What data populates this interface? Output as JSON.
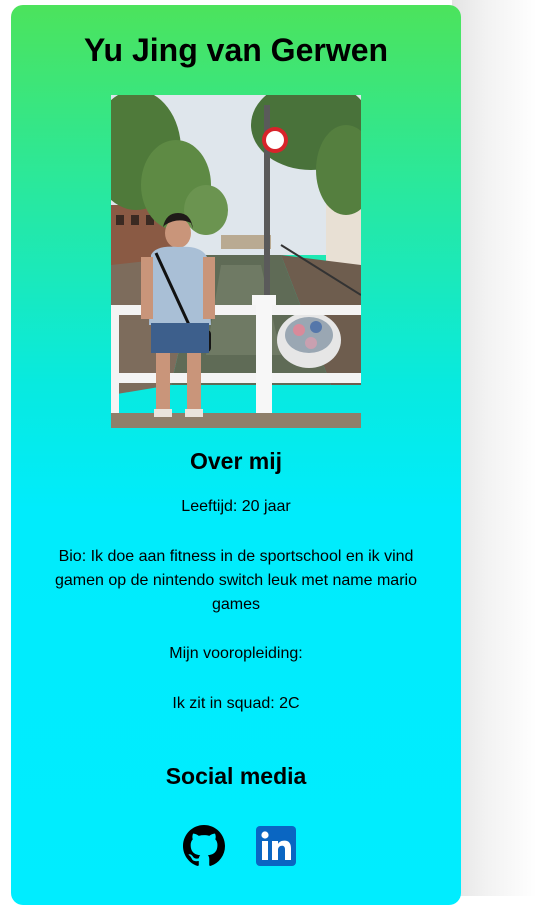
{
  "profile": {
    "name": "Yu Jing van Gerwen"
  },
  "about": {
    "title": "Over mij",
    "age": "Leeftijd: 20 jaar",
    "bio": "Bio: Ik doe aan fitness in de sportschool en ik vind gamen op de nintendo switch leuk met name mario games",
    "previous_education": "Mijn vooropleiding:",
    "squad": "Ik zit in squad: 2C"
  },
  "social": {
    "title": "Social media",
    "links": [
      {
        "icon": "github-icon"
      },
      {
        "icon": "linkedin-icon"
      }
    ]
  },
  "colors": {
    "gradient_top": "#4ce35c",
    "gradient_bottom": "#00edff",
    "linkedin_blue": "#0a66c2"
  }
}
